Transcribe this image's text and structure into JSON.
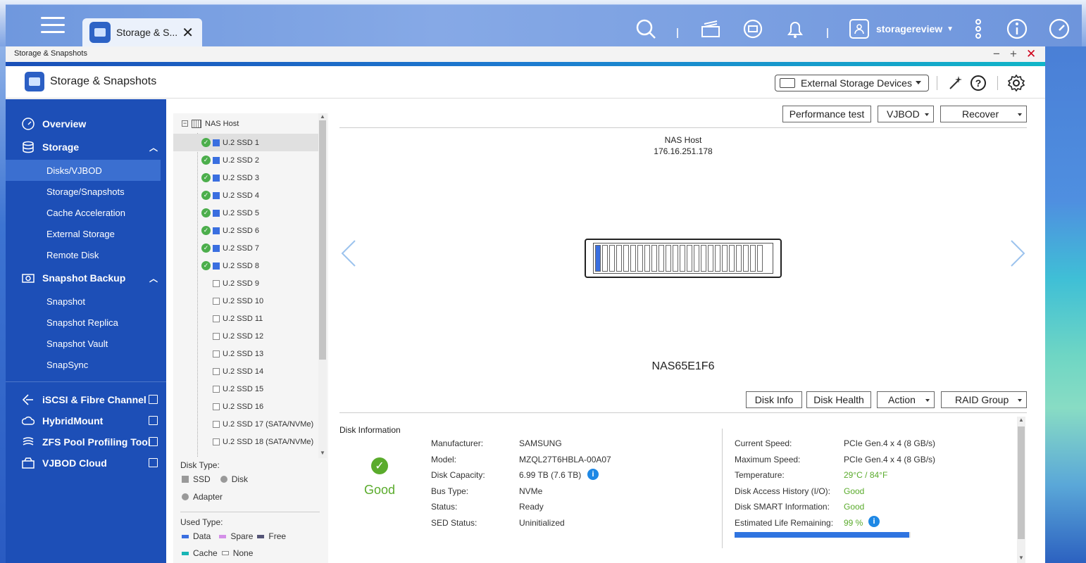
{
  "taskbar": {
    "tab_label": "Storage & S...",
    "username": "storagereview"
  },
  "window": {
    "title": "Storage & Snapshots"
  },
  "app": {
    "title": "Storage & Snapshots",
    "external_dropdown": "External Storage Devices"
  },
  "sidebar": {
    "overview": "Overview",
    "storage": "Storage",
    "storage_items": [
      "Disks/VJBOD",
      "Storage/Snapshots",
      "Cache Acceleration",
      "External Storage",
      "Remote Disk"
    ],
    "snapshot_backup": "Snapshot Backup",
    "snapshot_items": [
      "Snapshot",
      "Snapshot Replica",
      "Snapshot Vault",
      "SnapSync"
    ],
    "links": [
      "iSCSI & Fibre Channel",
      "HybridMount",
      "ZFS Pool Profiling Tool",
      "VJBOD Cloud"
    ]
  },
  "tree": {
    "root": "NAS Host",
    "disks": [
      "U.2 SSD 1",
      "U.2 SSD 2",
      "U.2 SSD 3",
      "U.2 SSD 4",
      "U.2 SSD 5",
      "U.2 SSD 6",
      "U.2 SSD 7",
      "U.2 SSD 8",
      "U.2 SSD 9",
      "U.2 SSD 10",
      "U.2 SSD 11",
      "U.2 SSD 12",
      "U.2 SSD 13",
      "U.2 SSD 14",
      "U.2 SSD 15",
      "U.2 SSD 16",
      "U.2 SSD 17 (SATA/NVMe)",
      "U.2 SSD 18 (SATA/NVMe)"
    ],
    "disk_type_label": "Disk Type:",
    "disk_types": [
      "SSD",
      "Disk",
      "Adapter"
    ],
    "used_type_label": "Used Type:",
    "used_types": [
      "Data",
      "Spare",
      "Free",
      "Cache",
      "None"
    ]
  },
  "toolbar": {
    "performance_test": "Performance test",
    "vjbod": "VJBOD",
    "recover": "Recover",
    "disk_info": "Disk Info",
    "disk_health": "Disk Health",
    "action": "Action",
    "raid_group": "RAID Group"
  },
  "nas": {
    "label": "NAS Host",
    "ip": "176.16.251.178",
    "name": "NAS65E1F6",
    "bays": 24,
    "active_bay": 1
  },
  "disk_info": {
    "title": "Disk Information",
    "status_text": "Good",
    "left": [
      {
        "k": "Manufacturer:",
        "v": "SAMSUNG"
      },
      {
        "k": "Model:",
        "v": "MZQL27T6HBLA-00A07"
      },
      {
        "k": "Disk Capacity:",
        "v": "6.99 TB (7.6 TB)"
      },
      {
        "k": "Bus Type:",
        "v": "NVMe"
      },
      {
        "k": "Status:",
        "v": "Ready"
      },
      {
        "k": "SED Status:",
        "v": "Uninitialized"
      }
    ],
    "right": [
      {
        "k": "Current Speed:",
        "v": "PCIe Gen.4 x 4 (8 GB/s)"
      },
      {
        "k": "Maximum Speed:",
        "v": "PCIe Gen.4 x 4 (8 GB/s)"
      },
      {
        "k": "Temperature:",
        "v": "29°C / 84°F"
      },
      {
        "k": "Disk Access History (I/O):",
        "v": "Good"
      },
      {
        "k": "Disk SMART Information:",
        "v": "Good"
      },
      {
        "k": "Estimated Life Remaining:",
        "v": "99 %"
      }
    ],
    "life_remaining_fraction": 0.99
  },
  "colors": {
    "sidebar_bg": "#1d4fb7",
    "active_item": "#3b6fd0",
    "good_green": "#5aab2c",
    "data_blue": "#3a6fe0"
  }
}
